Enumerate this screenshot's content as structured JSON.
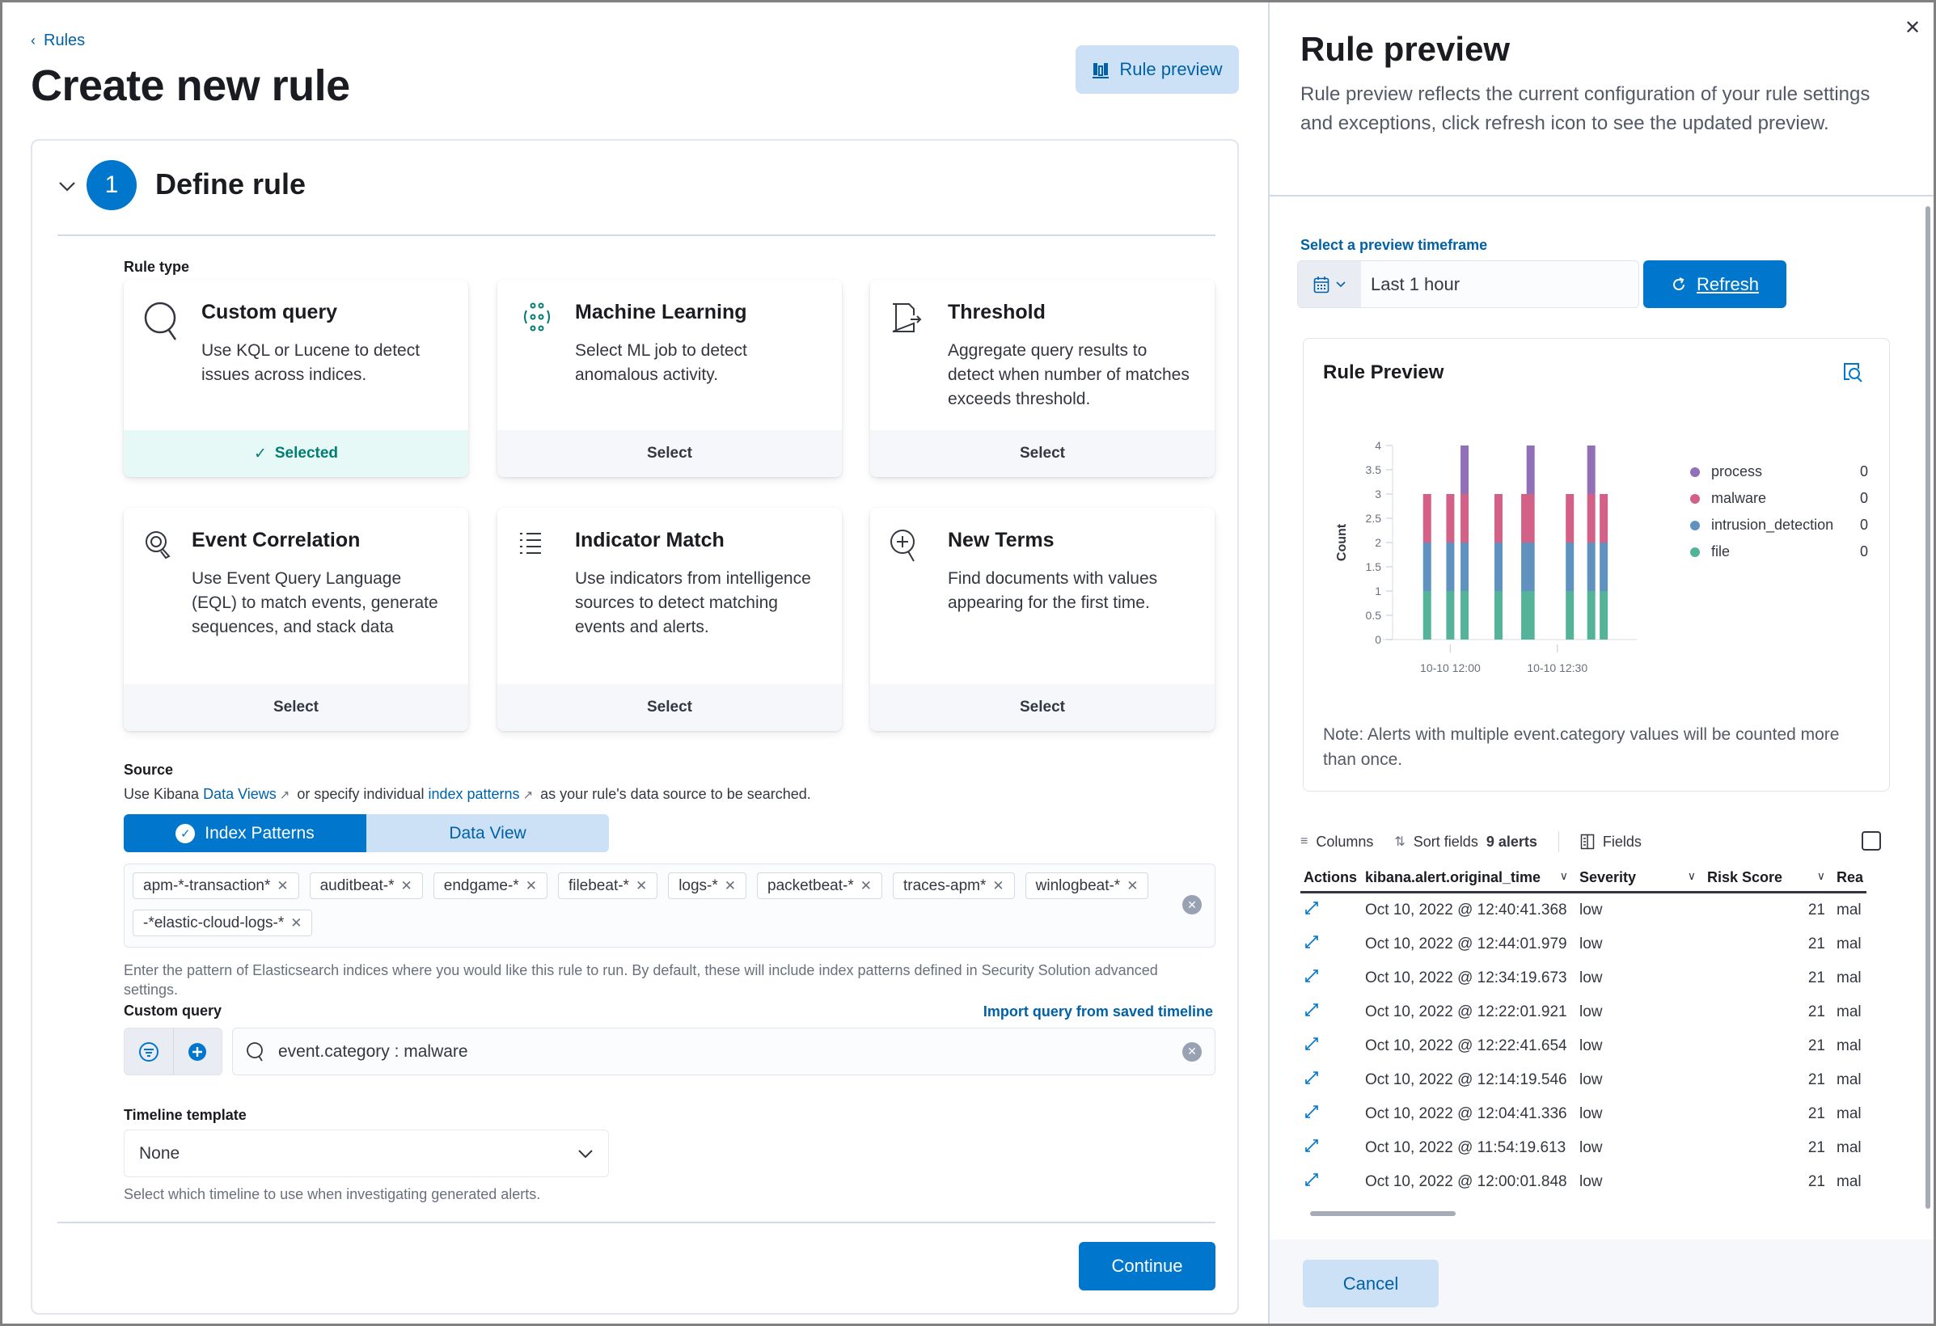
{
  "page": {
    "breadcrumb": "Rules",
    "title": "Create new rule",
    "rule_preview_button": "Rule preview"
  },
  "step": {
    "number": "1",
    "title": "Define rule"
  },
  "rule_type": {
    "label": "Rule type",
    "cards": [
      {
        "title": "Custom query",
        "description": "Use KQL or Lucene to detect issues across indices.",
        "action": "Selected",
        "selected": true,
        "icon": "search-icon"
      },
      {
        "title": "Machine Learning",
        "description": "Select ML job to detect anomalous activity.",
        "action": "Select",
        "selected": false,
        "icon": "machine-learning-icon"
      },
      {
        "title": "Threshold",
        "description": "Aggregate query results to detect when number of matches exceeds threshold.",
        "action": "Select",
        "selected": false,
        "icon": "threshold-icon"
      },
      {
        "title": "Event Correlation",
        "description": "Use Event Query Language (EQL) to match events, generate sequences, and stack data",
        "action": "Select",
        "selected": false,
        "icon": "eql-icon"
      },
      {
        "title": "Indicator Match",
        "description": "Use indicators from intelligence sources to detect matching events and alerts.",
        "action": "Select",
        "selected": false,
        "icon": "list-icon"
      },
      {
        "title": "New Terms",
        "description": "Find documents with values appearing for the first time.",
        "action": "Select",
        "selected": false,
        "icon": "zoom-in-icon"
      }
    ]
  },
  "source": {
    "label": "Source",
    "desc_prefix": "Use Kibana",
    "link_data_views": "Data Views",
    "desc_middle": "or specify individual",
    "link_index_patterns": "index patterns",
    "desc_suffix": "as your rule's data source to be searched.",
    "toggle_index_patterns": "Index Patterns",
    "toggle_data_view": "Data View",
    "selected_toggle": "Index Patterns",
    "index_patterns": [
      "apm-*-transaction*",
      "auditbeat-*",
      "endgame-*",
      "filebeat-*",
      "logs-*",
      "packetbeat-*",
      "traces-apm*",
      "winlogbeat-*",
      "-*elastic-cloud-logs-*"
    ],
    "help": "Enter the pattern of Elasticsearch indices where you would like this rule to run. By default, these will include index patterns defined in Security Solution advanced settings."
  },
  "custom_query": {
    "label": "Custom query",
    "import_link": "Import query from saved timeline",
    "value": "event.category : malware"
  },
  "timeline_template": {
    "label": "Timeline template",
    "value": "None",
    "help": "Select which timeline to use when investigating generated alerts."
  },
  "continue_button": "Continue",
  "preview_panel": {
    "title": "Rule preview",
    "description": "Rule preview reflects the current configuration of your rule settings and exceptions, click refresh icon to see the updated preview.",
    "timeframe_label": "Select a preview timeframe",
    "timeframe_value": "Last 1 hour",
    "refresh_button": "Refresh",
    "chart_title": "Rule Preview",
    "note": "Note: Alerts with multiple event.category values will be counted more than once.",
    "toolbar": {
      "columns": "Columns",
      "sort_fields": "Sort fields",
      "alerts_count": "9 alerts",
      "fields": "Fields"
    },
    "table": {
      "headers": [
        "Actions",
        "kibana.alert.original_time",
        "Severity",
        "Risk Score",
        "Rea"
      ],
      "rows": [
        {
          "time": "Oct 10, 2022 @ 12:40:41.368",
          "severity": "low",
          "risk": "21",
          "reason": "mal"
        },
        {
          "time": "Oct 10, 2022 @ 12:44:01.979",
          "severity": "low",
          "risk": "21",
          "reason": "mal"
        },
        {
          "time": "Oct 10, 2022 @ 12:34:19.673",
          "severity": "low",
          "risk": "21",
          "reason": "mal"
        },
        {
          "time": "Oct 10, 2022 @ 12:22:01.921",
          "severity": "low",
          "risk": "21",
          "reason": "mal"
        },
        {
          "time": "Oct 10, 2022 @ 12:22:41.654",
          "severity": "low",
          "risk": "21",
          "reason": "mal"
        },
        {
          "time": "Oct 10, 2022 @ 12:14:19.546",
          "severity": "low",
          "risk": "21",
          "reason": "mal"
        },
        {
          "time": "Oct 10, 2022 @ 12:04:41.336",
          "severity": "low",
          "risk": "21",
          "reason": "mal"
        },
        {
          "time": "Oct 10, 2022 @ 11:54:19.613",
          "severity": "low",
          "risk": "21",
          "reason": "mal"
        },
        {
          "time": "Oct 10, 2022 @ 12:00:01.848",
          "severity": "low",
          "risk": "21",
          "reason": "mal"
        }
      ]
    },
    "cancel_button": "Cancel"
  },
  "colors": {
    "primary": "#0077cc",
    "link": "#0061a6",
    "selected_bg": "#e6f9f7",
    "selected_text": "#017d73"
  },
  "chart_data": {
    "type": "bar",
    "stacked": true,
    "title": "Rule Preview",
    "xlabel": "",
    "ylabel": "Count",
    "ylim": [
      0,
      4
    ],
    "yticks": [
      "0",
      "0.5",
      "1",
      "1.5",
      "2",
      "2.5",
      "3",
      "3.5",
      "4"
    ],
    "xticks": [
      {
        "label": "10-10 12:00",
        "minutes": 0
      },
      {
        "label": "10-10 12:30",
        "minutes": 30
      }
    ],
    "x_unit": "minutes relative to 10-10 12:00",
    "x": [
      -6.5,
      0,
      4,
      13.5,
      21,
      22.5,
      33.5,
      39.5,
      43
    ],
    "series": [
      {
        "name": "file",
        "color": "#54b399",
        "values": [
          1,
          1,
          1,
          1,
          1,
          1,
          1,
          1,
          1
        ]
      },
      {
        "name": "intrusion_detection",
        "color": "#6092c0",
        "values": [
          1,
          1,
          1,
          1,
          1,
          1,
          1,
          1,
          1
        ]
      },
      {
        "name": "malware",
        "color": "#d36086",
        "values": [
          1,
          1,
          1,
          1,
          1,
          1,
          1,
          1,
          1
        ]
      },
      {
        "name": "process",
        "color": "#9170b8",
        "values": [
          0,
          0,
          1,
          0,
          0,
          1,
          0,
          1,
          0
        ]
      }
    ],
    "legend": {
      "placement": "right",
      "items": [
        {
          "name": "process",
          "color": "#9170b8",
          "value": "0"
        },
        {
          "name": "malware",
          "color": "#d36086",
          "value": "0"
        },
        {
          "name": "intrusion_detection",
          "color": "#6092c0",
          "value": "0"
        },
        {
          "name": "file",
          "color": "#54b399",
          "value": "0"
        }
      ]
    },
    "grid": false
  }
}
